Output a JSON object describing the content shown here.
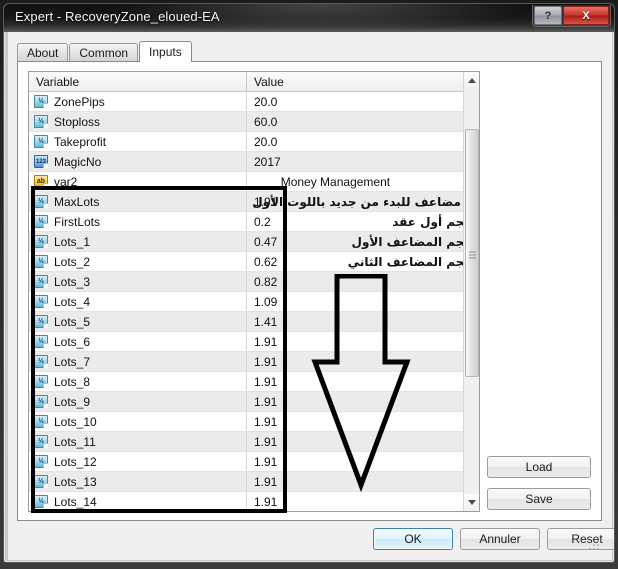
{
  "window": {
    "title": "Expert - RecoveryZone_eloued-EA",
    "caption_buttons": [
      {
        "name": "help-button",
        "label": "?"
      },
      {
        "name": "close-button",
        "label": "X"
      }
    ]
  },
  "tabs": [
    {
      "label": "About",
      "active": false
    },
    {
      "label": "Common",
      "active": false
    },
    {
      "label": "Inputs",
      "active": true
    }
  ],
  "grid": {
    "headers": {
      "variable": "Variable",
      "value": "Value"
    },
    "rows": [
      {
        "icon": "double-type-icon",
        "icon_glyph": "½",
        "icon_class": "double",
        "variable": "ZonePips",
        "value": "20.0",
        "annotation": ""
      },
      {
        "icon": "double-type-icon",
        "icon_glyph": "½",
        "icon_class": "double",
        "variable": "Stoploss",
        "value": "60.0",
        "annotation": ""
      },
      {
        "icon": "double-type-icon",
        "icon_glyph": "½",
        "icon_class": "double",
        "variable": "Takeprofit",
        "value": "20.0",
        "annotation": ""
      },
      {
        "icon": "integer-type-icon",
        "icon_glyph": "123",
        "icon_class": "int",
        "variable": "MagicNo",
        "value": "2017",
        "annotation": ""
      },
      {
        "icon": "string-type-icon",
        "icon_glyph": "ab",
        "icon_class": "str",
        "variable": "var2",
        "value": "____Money Management",
        "annotation": ""
      },
      {
        "icon": "double-type-icon",
        "icon_glyph": "½",
        "icon_class": "double",
        "variable": "MaxLots",
        "value": "1.91",
        "annotation": "أقصى مضاعف للبدء من جديد باللوت الأول",
        "annotation_overflow": true
      },
      {
        "icon": "double-type-icon",
        "icon_glyph": "½",
        "icon_class": "double",
        "variable": "FirstLots",
        "value": "0.2",
        "annotation": "حجم أول عقد"
      },
      {
        "icon": "double-type-icon",
        "icon_glyph": "½",
        "icon_class": "double",
        "variable": "Lots_1",
        "value": "0.47",
        "annotation": "حجم المضاعف الأول"
      },
      {
        "icon": "double-type-icon",
        "icon_glyph": "½",
        "icon_class": "double",
        "variable": "Lots_2",
        "value": "0.62",
        "annotation": "حجم المضاعف الثاني"
      },
      {
        "icon": "double-type-icon",
        "icon_glyph": "½",
        "icon_class": "double",
        "variable": "Lots_3",
        "value": "0.82",
        "annotation": ""
      },
      {
        "icon": "double-type-icon",
        "icon_glyph": "½",
        "icon_class": "double",
        "variable": "Lots_4",
        "value": "1.09",
        "annotation": ""
      },
      {
        "icon": "double-type-icon",
        "icon_glyph": "½",
        "icon_class": "double",
        "variable": "Lots_5",
        "value": "1.41",
        "annotation": ""
      },
      {
        "icon": "double-type-icon",
        "icon_glyph": "½",
        "icon_class": "double",
        "variable": "Lots_6",
        "value": "1.91",
        "annotation": ""
      },
      {
        "icon": "double-type-icon",
        "icon_glyph": "½",
        "icon_class": "double",
        "variable": "Lots_7",
        "value": "1.91",
        "annotation": ""
      },
      {
        "icon": "double-type-icon",
        "icon_glyph": "½",
        "icon_class": "double",
        "variable": "Lots_8",
        "value": "1.91",
        "annotation": ""
      },
      {
        "icon": "double-type-icon",
        "icon_glyph": "½",
        "icon_class": "double",
        "variable": "Lots_9",
        "value": "1.91",
        "annotation": ""
      },
      {
        "icon": "double-type-icon",
        "icon_glyph": "½",
        "icon_class": "double",
        "variable": "Lots_10",
        "value": "1.91",
        "annotation": ""
      },
      {
        "icon": "double-type-icon",
        "icon_glyph": "½",
        "icon_class": "double",
        "variable": "Lots_11",
        "value": "1.91",
        "annotation": ""
      },
      {
        "icon": "double-type-icon",
        "icon_glyph": "½",
        "icon_class": "double",
        "variable": "Lots_12",
        "value": "1.91",
        "annotation": ""
      },
      {
        "icon": "double-type-icon",
        "icon_glyph": "½",
        "icon_class": "double",
        "variable": "Lots_13",
        "value": "1.91",
        "annotation": ""
      },
      {
        "icon": "double-type-icon",
        "icon_glyph": "½",
        "icon_class": "double",
        "variable": "Lots_14",
        "value": "1.91",
        "annotation": ""
      }
    ]
  },
  "side_buttons": [
    {
      "name": "load-button",
      "label": "Load"
    },
    {
      "name": "save-button",
      "label": "Save"
    }
  ],
  "footer_buttons": [
    {
      "name": "ok-button",
      "label": "OK",
      "default": true
    },
    {
      "name": "cancel-button",
      "label": "Annuler",
      "default": false
    },
    {
      "name": "reset-button",
      "label": "Reset",
      "default": false
    }
  ],
  "annotations": {
    "highlight_rect": "black-rectangle-highlight",
    "arrow": "black-down-arrow"
  },
  "colors": {
    "accent": "#3c7fb1",
    "close_button": "#c7352b",
    "annotation": "#000000",
    "row_alt": "#ebebeb"
  }
}
